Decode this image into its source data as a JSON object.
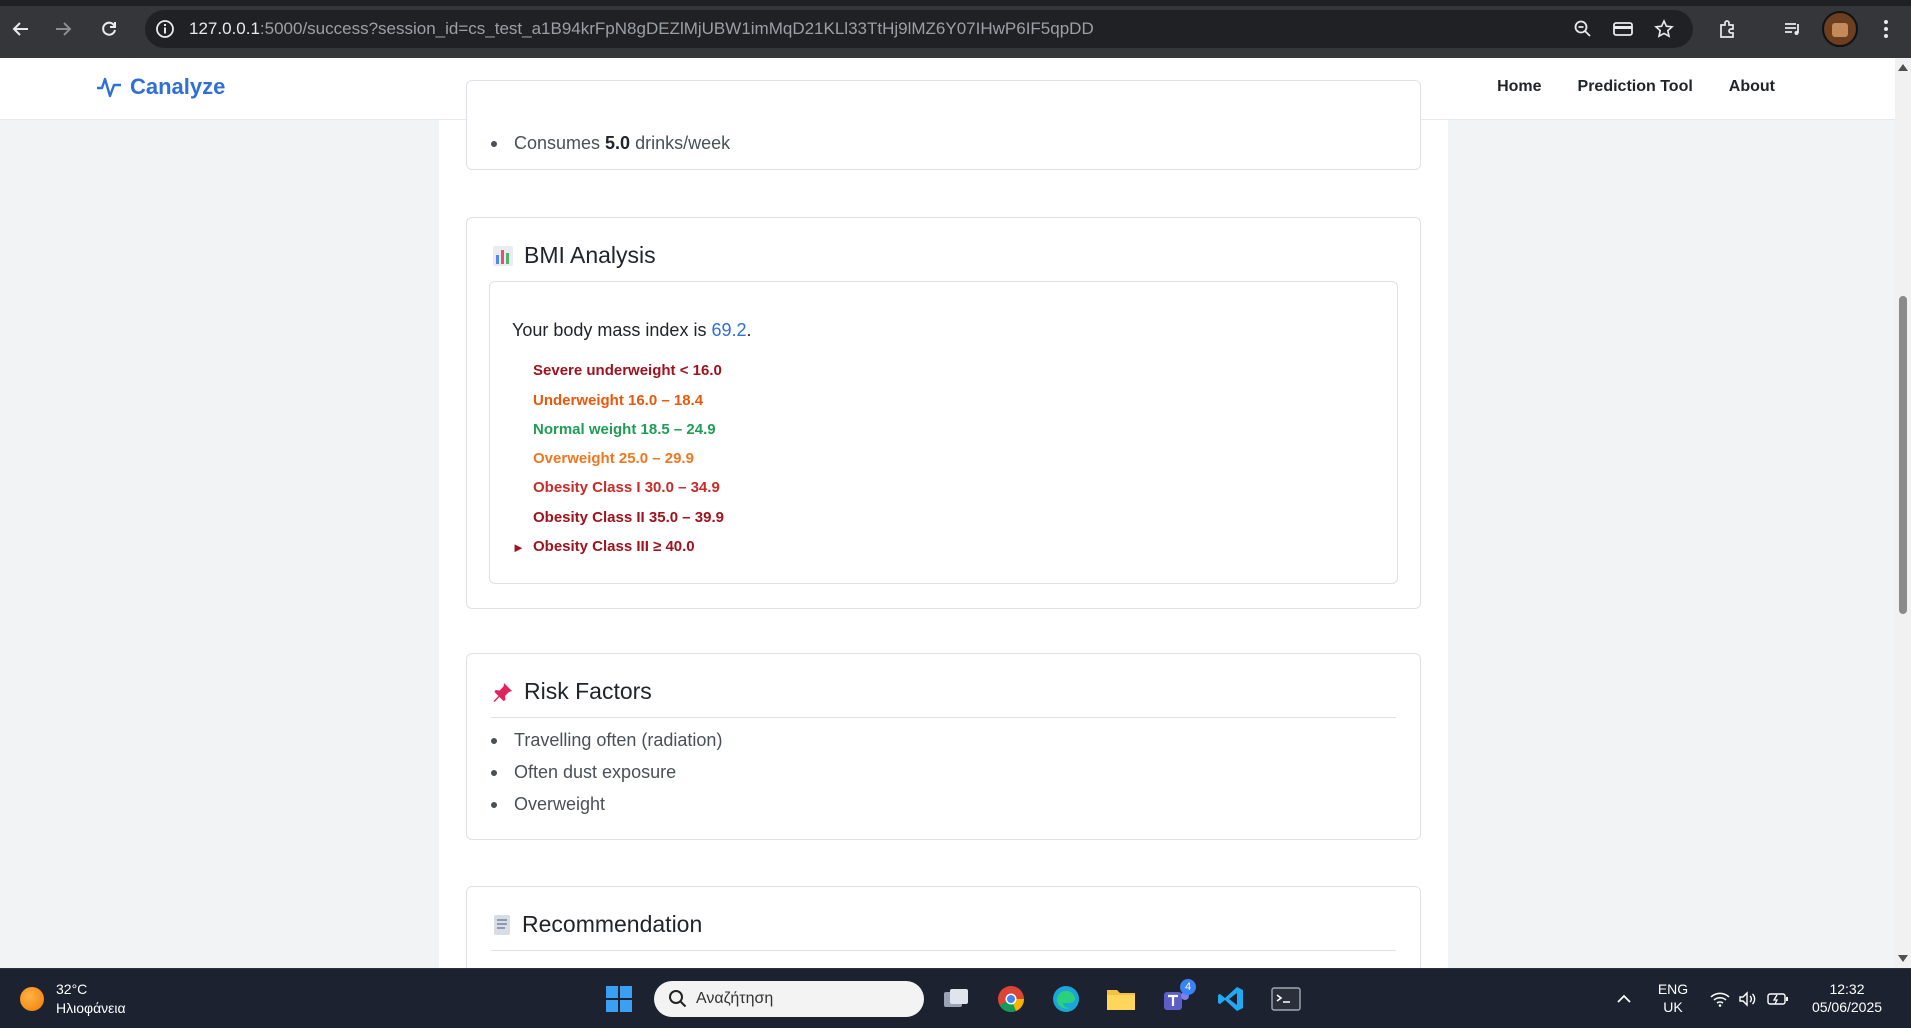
{
  "browser": {
    "url_host": "127.0.0.1",
    "url_rest": ":5000/success?session_id=cs_test_a1B94krFpN8gDEZlMjUBW1imMqD21KLl33TtHj9lMZ6Y07IHwP6IF5qpDD"
  },
  "navbar": {
    "brand": "Canalyze",
    "links": [
      "Home",
      "Prediction Tool",
      "About"
    ]
  },
  "lifestyle": {
    "items": [
      {
        "prefix": "Consumes ",
        "value": "5.0",
        "suffix": " drinks/week"
      }
    ]
  },
  "bmi": {
    "icon": "bar-chart-icon",
    "title": "BMI Analysis",
    "line_prefix": "Your body mass index is ",
    "value": "69.2",
    "line_suffix": ".",
    "categories": [
      {
        "label": "Severe underweight < 16.0",
        "color": "#a0121d"
      },
      {
        "label": "Underweight 16.0 – 18.4",
        "color": "#e8590c"
      },
      {
        "label": "Normal weight 18.5 – 24.9",
        "color": "#1f9d55"
      },
      {
        "label": "Overweight 25.0 – 29.9",
        "color": "#f0771f"
      },
      {
        "label": "Obesity Class I 30.0 – 34.9",
        "color": "#c92a2a"
      },
      {
        "label": "Obesity Class II 35.0 – 39.9",
        "color": "#a0121d"
      },
      {
        "label": "Obesity Class III ≥ 40.0",
        "color": "#a0121d"
      }
    ],
    "marker": "►"
  },
  "risk": {
    "icon": "pushpin-icon",
    "title": "Risk Factors",
    "items": [
      "Travelling often (radiation)",
      "Often dust exposure",
      "Overweight"
    ]
  },
  "recommendation": {
    "icon": "memo-icon",
    "title": "Recommendation"
  },
  "taskbar": {
    "temp": "32°C",
    "weather": "Ηλιοφάνεια",
    "search_placeholder": "Αναζήτηση",
    "teams_badge": "4",
    "lang_top": "ENG",
    "lang_bottom": "UK",
    "time": "12:32",
    "date": "05/06/2025"
  },
  "colors": {
    "brand": "#2f6fd6",
    "chrome": "#35363a",
    "taskbar": "#1c2230"
  }
}
